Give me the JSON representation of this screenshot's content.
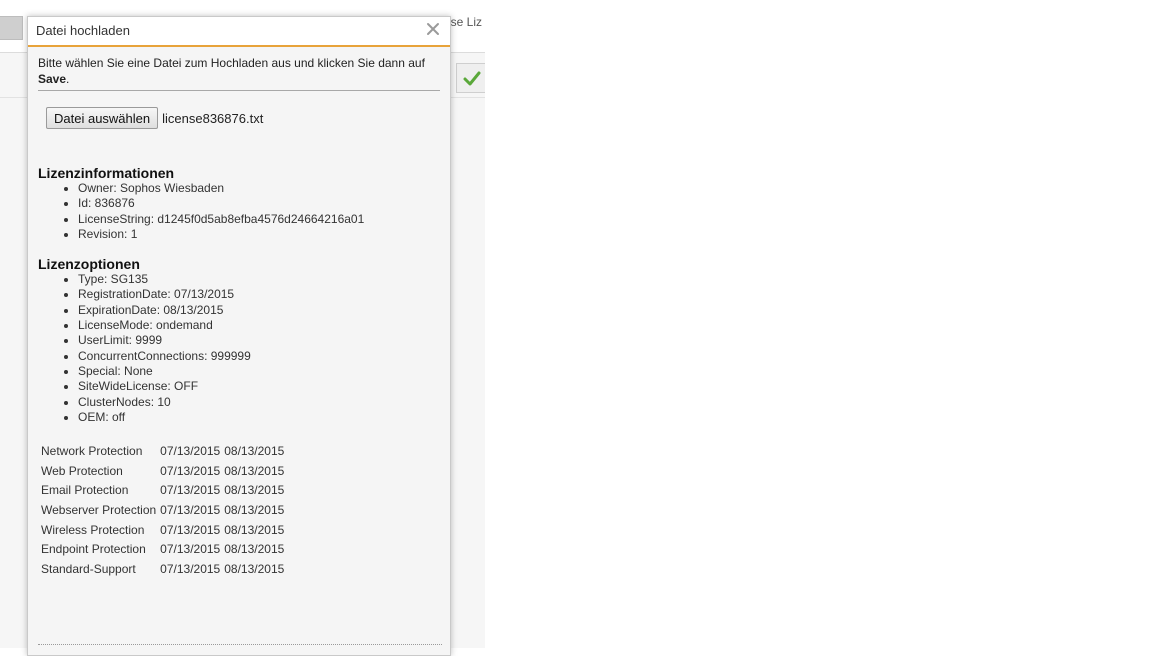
{
  "background": {
    "partial_text": "ese Liz"
  },
  "dialog": {
    "title": "Datei hochladen",
    "instruction_text": "Bitte wählen Sie eine Datei zum Hochladen aus und klicken Sie dann auf ",
    "instruction_bold": "Save",
    "instruction_end": ".",
    "file_button_label": "Datei auswählen",
    "file_name": "license836876.txt",
    "license_info": {
      "heading": "Lizenzinformationen",
      "items": [
        "Owner: Sophos Wiesbaden",
        "Id: 836876",
        "LicenseString: d1245f0d5ab8efba4576d24664216a01",
        "Revision: 1"
      ]
    },
    "license_options": {
      "heading": "Lizenzoptionen",
      "items": [
        "Type: SG135",
        "RegistrationDate: 07/13/2015",
        "ExpirationDate: 08/13/2015",
        "LicenseMode: ondemand",
        "UserLimit: 9999",
        "ConcurrentConnections: 999999",
        "Special: None",
        "SiteWideLicense: OFF",
        "ClusterNodes: 10",
        "OEM: off"
      ]
    },
    "modules": [
      {
        "name": "Network Protection",
        "start": "07/13/2015",
        "end": "08/13/2015"
      },
      {
        "name": "Web Protection",
        "start": "07/13/2015",
        "end": "08/13/2015"
      },
      {
        "name": "Email Protection",
        "start": "07/13/2015",
        "end": "08/13/2015"
      },
      {
        "name": "Webserver Protection",
        "start": "07/13/2015",
        "end": "08/13/2015"
      },
      {
        "name": "Wireless Protection",
        "start": "07/13/2015",
        "end": "08/13/2015"
      },
      {
        "name": "Endpoint Protection",
        "start": "07/13/2015",
        "end": "08/13/2015"
      },
      {
        "name": "Standard-Support",
        "start": "07/13/2015",
        "end": "08/13/2015"
      }
    ]
  },
  "colors": {
    "header_accent": "#e8a33a",
    "check_green": "#5aa83a"
  },
  "icons": {
    "close": "close-icon",
    "confirm": "checkmark-icon"
  }
}
